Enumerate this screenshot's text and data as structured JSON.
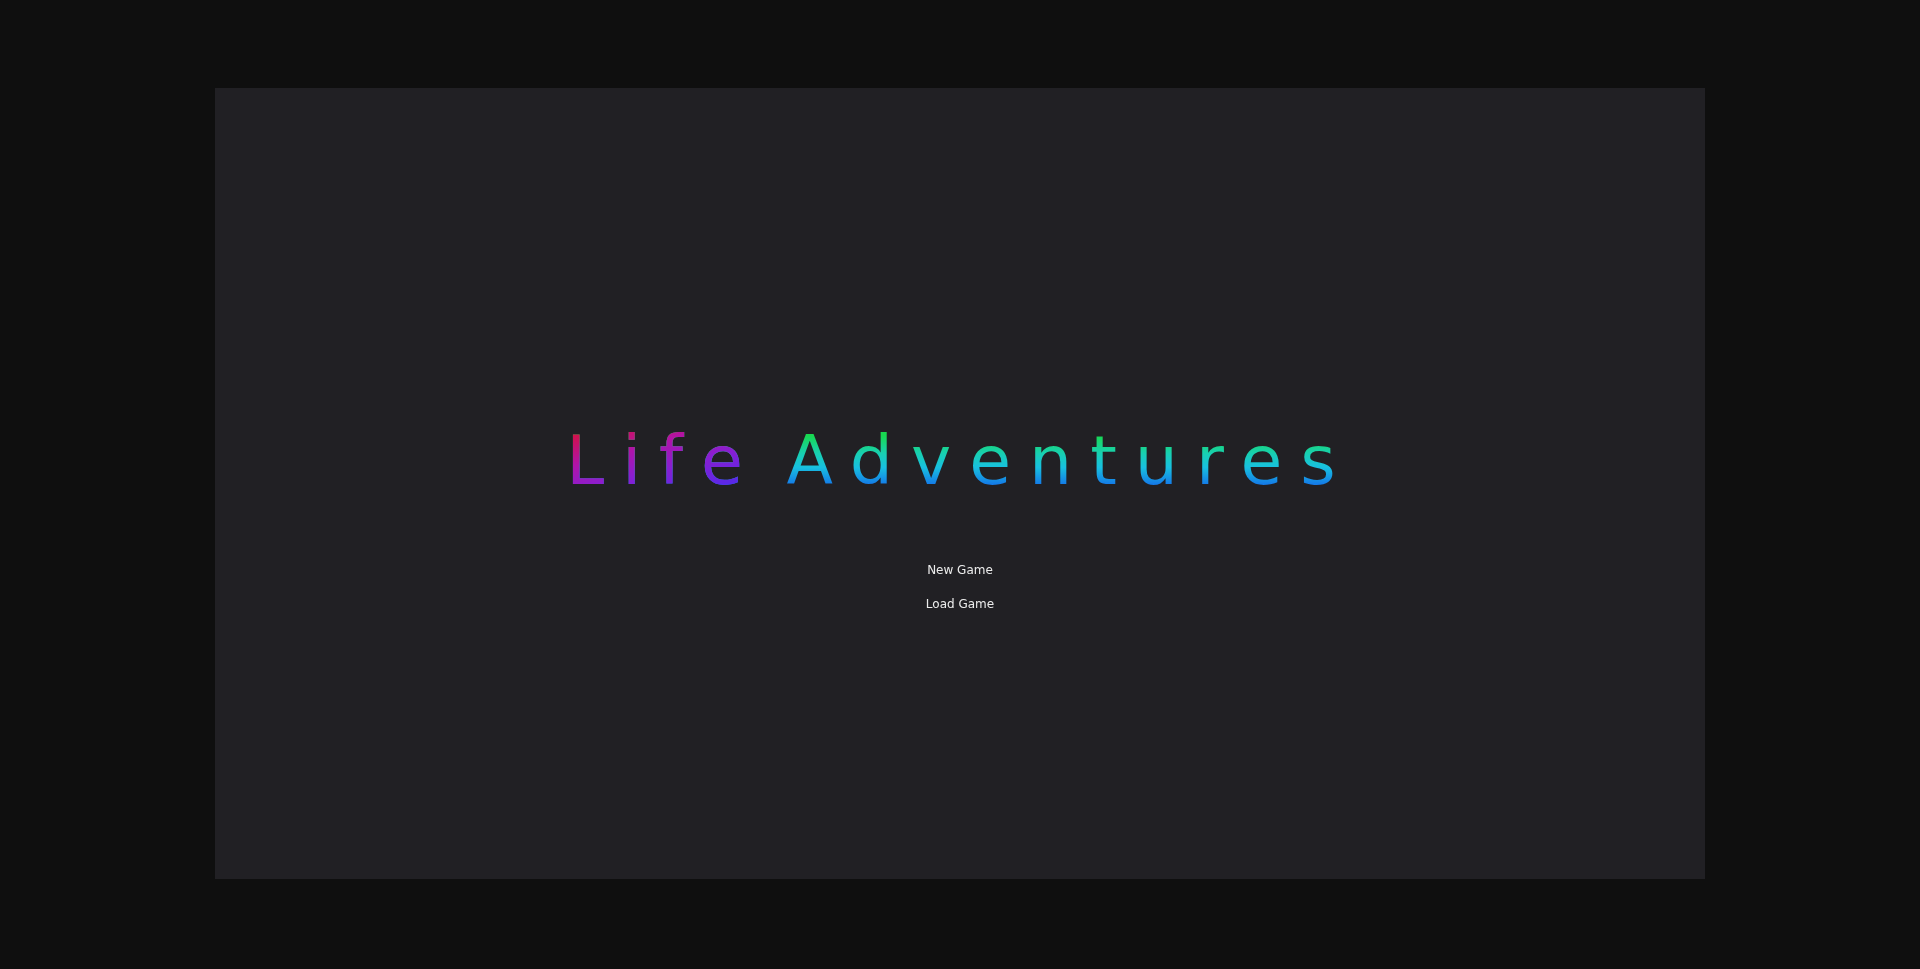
{
  "title": "Life Adventures",
  "menu": [
    {
      "label": "New Game"
    },
    {
      "label": "Load Game"
    }
  ]
}
